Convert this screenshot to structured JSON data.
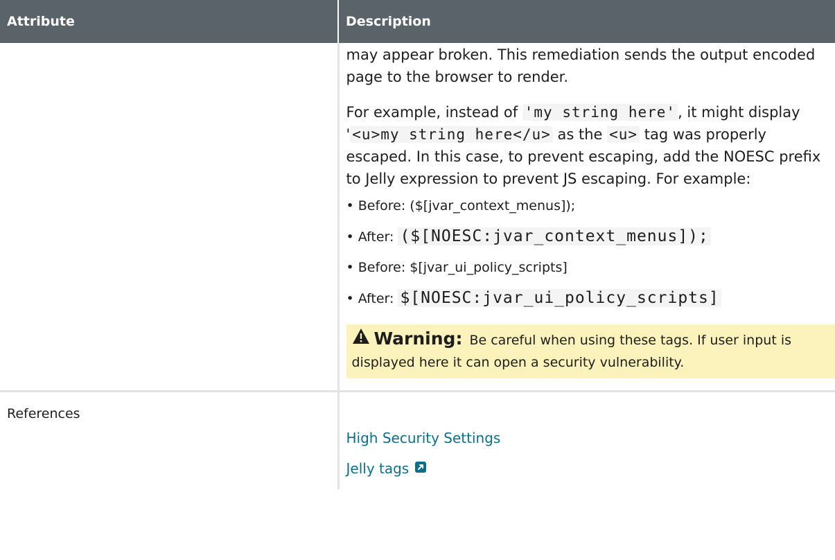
{
  "table": {
    "headers": {
      "attribute": "Attribute",
      "description": "Description"
    }
  },
  "noesc_row": {
    "para1": "may appear broken. This remediation sends the output encoded page to the browser to render.",
    "para2": {
      "t1": "For example, instead of ",
      "c1": "'my string here'",
      "t2": ", it might display '",
      "c2": "<u>my string here</u>",
      "t3": " as the ",
      "c3": "<u>",
      "t4": " tag was properly escaped. In this case, to prevent escaping, add the NOESC prefix to Jelly expression to prevent JS escaping. For example:"
    },
    "examples": [
      {
        "label": "Before: ",
        "value": "($[jvar_context_menus]);",
        "mono": false
      },
      {
        "label": "After: ",
        "value": "($[NOESC:jvar_context_menus]);",
        "mono": true
      },
      {
        "label": "Before: ",
        "value": "$[jvar_ui_policy_scripts]",
        "mono": false
      },
      {
        "label": "After: ",
        "value": "$[NOESC:jvar_ui_policy_scripts]",
        "mono": true
      }
    ],
    "warning": {
      "icon": "warning-triangle-icon",
      "title": "Warning:",
      "text": "Be careful when using these tags. If user input is displayed here it can open a security vulnerability."
    }
  },
  "references_row": {
    "label": "References",
    "links": [
      {
        "text": "High Security Settings",
        "external": false
      },
      {
        "text": "Jelly tags",
        "external": true,
        "icon": "external-link-icon"
      }
    ]
  },
  "colors": {
    "header_bg": "#5a6369",
    "warning_bg": "#fbf3bb",
    "link": "#0b6f8a"
  }
}
